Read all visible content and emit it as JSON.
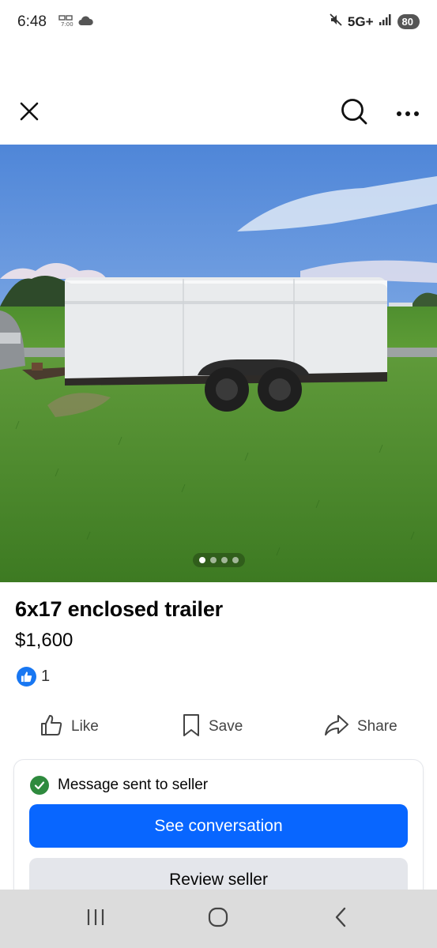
{
  "status_bar": {
    "time": "6:48",
    "network": "5G+",
    "battery": "80",
    "icons": [
      "notification-icon",
      "cloud-icon",
      "mute-icon",
      "signal-icon",
      "battery-icon"
    ]
  },
  "top_bar": {
    "icons": [
      "close-icon",
      "search-icon",
      "more-icon"
    ]
  },
  "photo": {
    "description_icon": "listing-photo",
    "pager_total": 4,
    "pager_active": 1
  },
  "listing": {
    "title": "6x17 enclosed trailer",
    "price": "$1,600",
    "like_count": "1"
  },
  "actions": {
    "like_label": "Like",
    "save_label": "Save",
    "share_label": "Share"
  },
  "message_card": {
    "status": "Message sent to seller",
    "primary_button": "See conversation",
    "secondary_button": "Review seller"
  },
  "colors": {
    "accent": "#0866ff",
    "like_blue": "#1877f2",
    "success_green": "#2e8a3e",
    "secondary_bg": "#e4e6eb",
    "nav_bg": "#dcdcdc"
  }
}
